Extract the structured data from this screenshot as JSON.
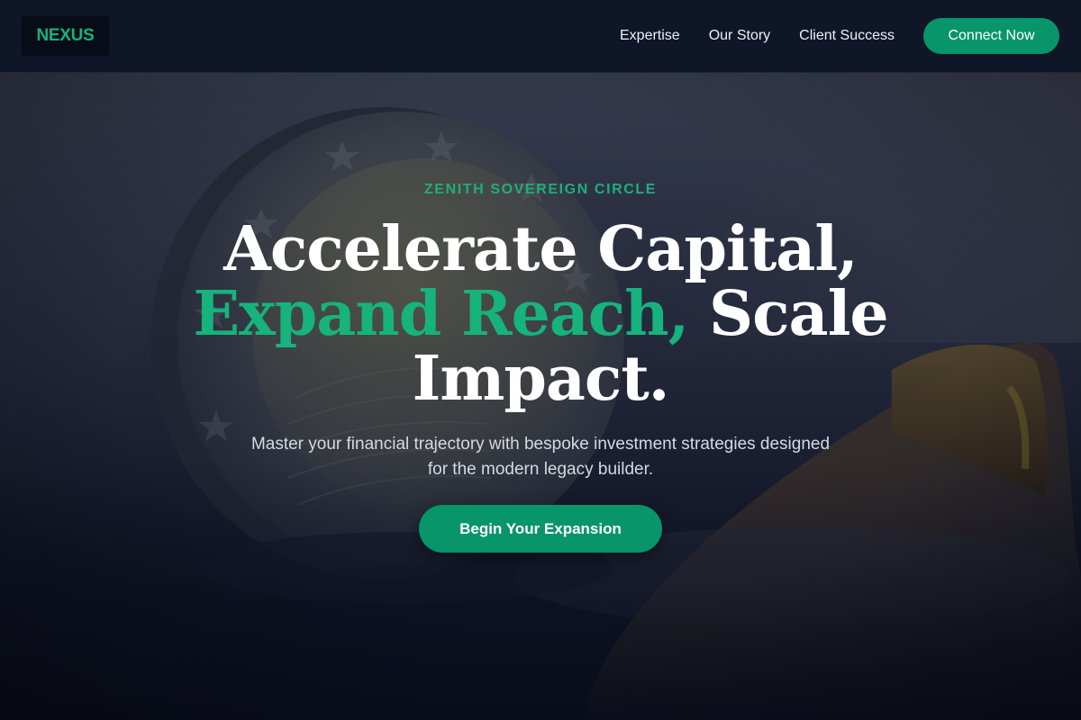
{
  "brand": {
    "logo_text": "NEXUS",
    "accent_color": "#16b37c",
    "button_color": "#079569"
  },
  "nav": {
    "links": [
      {
        "label": "Expertise"
      },
      {
        "label": "Our Story"
      },
      {
        "label": "Client Success"
      }
    ],
    "cta_label": "Connect Now"
  },
  "hero": {
    "eyebrow": "ZENITH SOVEREIGN CIRCLE",
    "headline_line1": "Accelerate Capital,",
    "headline_accent": "Expand Reach,",
    "headline_rest": " Scale",
    "headline_line3": "Impact.",
    "subtext": "Master your financial trajectory with bespoke investment strategies designed for the modern legacy builder.",
    "cta_label": "Begin Your Expansion",
    "background_image": "coin-background"
  }
}
